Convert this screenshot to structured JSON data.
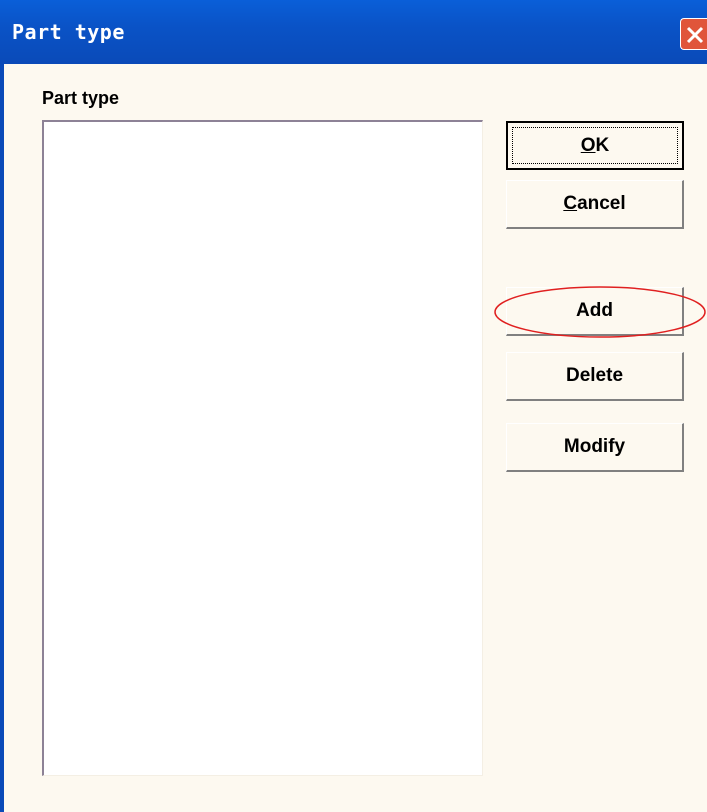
{
  "window": {
    "title": "Part type"
  },
  "list": {
    "label": "Part type",
    "items": []
  },
  "buttons": {
    "ok": {
      "mnemonic": "O",
      "rest": "K"
    },
    "cancel": {
      "mnemonic": "C",
      "rest": "ancel"
    },
    "add": "Add",
    "delete": "Delete",
    "modify": "Modify"
  },
  "icons": {
    "close": "close-icon"
  },
  "colors": {
    "titlebar": "#0a53c7",
    "close_button": "#e0553a",
    "dialog_background": "#fdf9f0",
    "annotation": "#e02020"
  }
}
